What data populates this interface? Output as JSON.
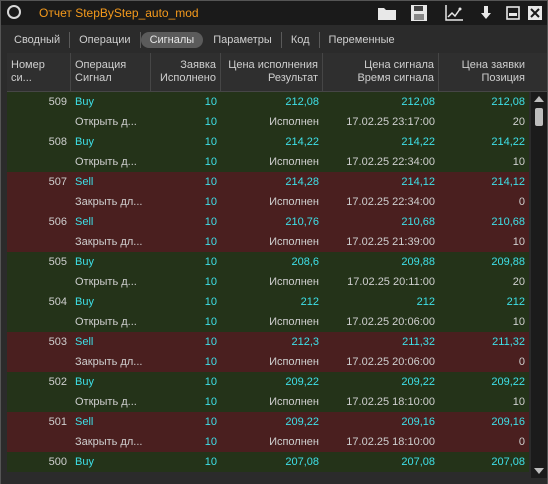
{
  "window": {
    "title": "Отчет StepByStep_auto_mod"
  },
  "tabs": [
    "Сводный",
    "Операции",
    "Сигналы",
    "Параметры",
    "Код",
    "Переменные"
  ],
  "active_tab": "Сигналы",
  "columns": {
    "c0": {
      "l1": "Номер си...",
      "l2": ""
    },
    "c1": {
      "l1": "Операция",
      "l2": "Сигнал"
    },
    "c2": {
      "l1": "Заявка",
      "l2": "Исполнено"
    },
    "c3": {
      "l1": "Цена исполнения",
      "l2": "Результат"
    },
    "c4": {
      "l1": "Цена сигнала",
      "l2": "Время сигнала"
    },
    "c5": {
      "l1": "Цена заявки",
      "l2": "Позиция"
    }
  },
  "rows": [
    {
      "type": "buy",
      "num": "509",
      "op": "Buy",
      "qty": "10",
      "exec": "212,08",
      "sig_price": "212,08",
      "order_price": "212,08"
    },
    {
      "type": "buy",
      "num": "",
      "op": "Открыть д...",
      "qty": "10",
      "exec": "Исполнен",
      "sig_price": "17.02.25 23:17:00",
      "order_price": "20",
      "sub": true
    },
    {
      "type": "buy",
      "num": "508",
      "op": "Buy",
      "qty": "10",
      "exec": "214,22",
      "sig_price": "214,22",
      "order_price": "214,22"
    },
    {
      "type": "buy",
      "num": "",
      "op": "Открыть д...",
      "qty": "10",
      "exec": "Исполнен",
      "sig_price": "17.02.25 22:34:00",
      "order_price": "10",
      "sub": true
    },
    {
      "type": "sell",
      "num": "507",
      "op": "Sell",
      "qty": "10",
      "exec": "214,28",
      "sig_price": "214,12",
      "order_price": "214,12"
    },
    {
      "type": "sell",
      "num": "",
      "op": "Закрыть дл...",
      "qty": "10",
      "exec": "Исполнен",
      "sig_price": "17.02.25 22:34:00",
      "order_price": "0",
      "sub": true
    },
    {
      "type": "sell",
      "num": "506",
      "op": "Sell",
      "qty": "10",
      "exec": "210,76",
      "sig_price": "210,68",
      "order_price": "210,68"
    },
    {
      "type": "sell",
      "num": "",
      "op": "Закрыть дл...",
      "qty": "10",
      "exec": "Исполнен",
      "sig_price": "17.02.25 21:39:00",
      "order_price": "10",
      "sub": true
    },
    {
      "type": "buy",
      "num": "505",
      "op": "Buy",
      "qty": "10",
      "exec": "208,6",
      "sig_price": "209,88",
      "order_price": "209,88"
    },
    {
      "type": "buy",
      "num": "",
      "op": "Открыть д...",
      "qty": "10",
      "exec": "Исполнен",
      "sig_price": "17.02.25 20:11:00",
      "order_price": "20",
      "sub": true
    },
    {
      "type": "buy",
      "num": "504",
      "op": "Buy",
      "qty": "10",
      "exec": "212",
      "sig_price": "212",
      "order_price": "212"
    },
    {
      "type": "buy",
      "num": "",
      "op": "Открыть д...",
      "qty": "10",
      "exec": "Исполнен",
      "sig_price": "17.02.25 20:06:00",
      "order_price": "10",
      "sub": true
    },
    {
      "type": "sell",
      "num": "503",
      "op": "Sell",
      "qty": "10",
      "exec": "212,3",
      "sig_price": "211,32",
      "order_price": "211,32"
    },
    {
      "type": "sell",
      "num": "",
      "op": "Закрыть дл...",
      "qty": "10",
      "exec": "Исполнен",
      "sig_price": "17.02.25 20:06:00",
      "order_price": "0",
      "sub": true
    },
    {
      "type": "buy",
      "num": "502",
      "op": "Buy",
      "qty": "10",
      "exec": "209,22",
      "sig_price": "209,22",
      "order_price": "209,22"
    },
    {
      "type": "buy",
      "num": "",
      "op": "Открыть д...",
      "qty": "10",
      "exec": "Исполнен",
      "sig_price": "17.02.25 18:10:00",
      "order_price": "10",
      "sub": true
    },
    {
      "type": "sell",
      "num": "501",
      "op": "Sell",
      "qty": "10",
      "exec": "209,22",
      "sig_price": "209,16",
      "order_price": "209,16"
    },
    {
      "type": "sell",
      "num": "",
      "op": "Закрыть дл...",
      "qty": "10",
      "exec": "Исполнен",
      "sig_price": "17.02.25 18:10:00",
      "order_price": "0",
      "sub": true
    },
    {
      "type": "buy",
      "num": "500",
      "op": "Buy",
      "qty": "10",
      "exec": "207,08",
      "sig_price": "207,08",
      "order_price": "207,08"
    }
  ],
  "colors": {
    "buy_row": "#243319",
    "sell_row": "#4a1f1f",
    "accent": "#3ee0e8",
    "title": "#f59a1c"
  },
  "icons": [
    "app-ring-icon",
    "folder-icon",
    "save-icon",
    "chart-icon",
    "download-icon",
    "minimize-icon",
    "close-icon"
  ]
}
